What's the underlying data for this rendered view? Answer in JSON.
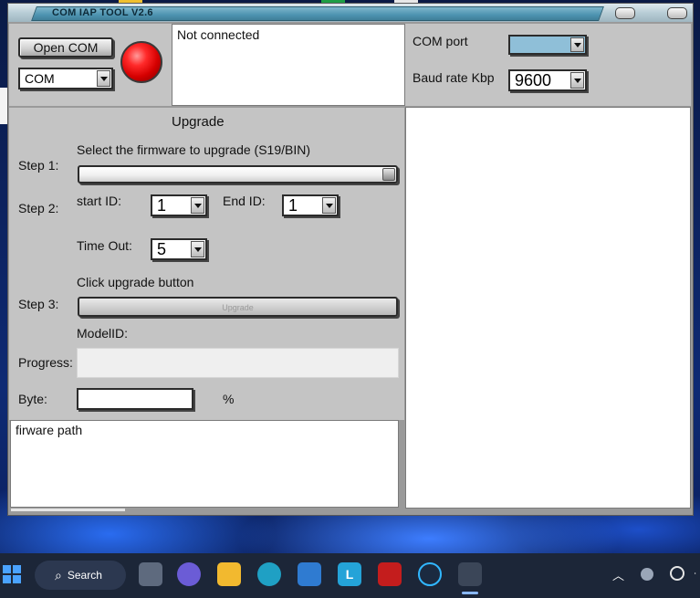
{
  "window": {
    "title": "COM IAP  TOOL V2.6"
  },
  "connection": {
    "open_button": "Open COM",
    "com_select": "COM",
    "status_text": "Not connected",
    "com_port_label": "COM port",
    "com_port_value": "",
    "baud_label": "Baud rate Kbp",
    "baud_value": "9600"
  },
  "upgrade": {
    "heading": "Upgrade",
    "firmware_hint": "Select the firmware  to upgrade (S19/BIN)",
    "step1": "Step 1:",
    "step2": "Step 2:",
    "step3": "Step 3:",
    "start_id_label": "start ID:",
    "start_id_value": "1",
    "end_id_label": "End ID:",
    "end_id_value": "1",
    "timeout_label": "Time Out:",
    "timeout_value": "5",
    "click_upgrade": "Click upgrade button",
    "upgrade_button": "Upgrade",
    "model_id_label": "ModelID:",
    "progress_label": "Progress:",
    "byte_label": "Byte:",
    "byte_value": "",
    "percent": "%",
    "path_text": "firware path"
  },
  "taskbar": {
    "search_label": "Search",
    "app_l_label": "L",
    "colors": {
      "bar": "#1c2638",
      "accent": "#4aa3ff"
    }
  }
}
